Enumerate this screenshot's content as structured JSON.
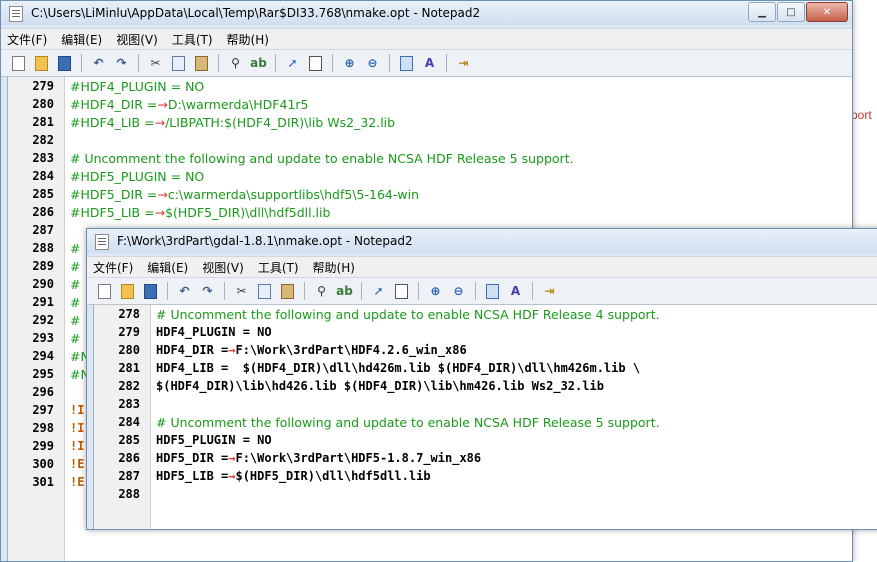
{
  "background": {
    "text": "port"
  },
  "window1": {
    "title": "C:\\Users\\LiMinlu\\AppData\\Local\\Temp\\Rar$DI33.768\\nmake.opt - Notepad2",
    "menu": [
      "文件(F)",
      "编辑(E)",
      "视图(V)",
      "工具(T)",
      "帮助(H)"
    ],
    "lines": [
      {
        "n": "279",
        "t": "#HDF4_PLUGIN = NO",
        "k": "cmt"
      },
      {
        "n": "280",
        "t": "#HDF4_DIR =→D:\\warmerda\\HDF41r5",
        "k": "cmt"
      },
      {
        "n": "281",
        "t": "#HDF4_LIB =→/LIBPATH:$(HDF4_DIR)\\lib Ws2_32.lib",
        "k": "cmt"
      },
      {
        "n": "282",
        "t": "",
        "k": "cmt"
      },
      {
        "n": "283",
        "t": "# Uncomment the following and update to enable NCSA HDF Release 5 support.",
        "k": "cmt"
      },
      {
        "n": "284",
        "t": "#HDF5_PLUGIN = NO",
        "k": "cmt"
      },
      {
        "n": "285",
        "t": "#HDF5_DIR =→c:\\warmerda\\supportlibs\\hdf5\\5-164-win",
        "k": "cmt"
      },
      {
        "n": "286",
        "t": "#HDF5_LIB =→$(HDF5_DIR)\\dll\\hdf5dll.lib",
        "k": "cmt"
      },
      {
        "n": "287",
        "t": "",
        "k": "cmt"
      },
      {
        "n": "288",
        "t": "#",
        "k": "cmt"
      },
      {
        "n": "289",
        "t": "#",
        "k": "cmt"
      },
      {
        "n": "290",
        "t": "#",
        "k": "cmt"
      },
      {
        "n": "291",
        "t": "#",
        "k": "cmt"
      },
      {
        "n": "292",
        "t": "#",
        "k": "cmt"
      },
      {
        "n": "293",
        "t": "#",
        "k": "cmt"
      },
      {
        "n": "294",
        "t": "#N",
        "k": "cmt"
      },
      {
        "n": "295",
        "t": "#N",
        "k": "cmt"
      },
      {
        "n": "296",
        "t": "",
        "k": "cmt"
      },
      {
        "n": "297",
        "t": "!I",
        "k": "warn"
      },
      {
        "n": "298",
        "t": "!I",
        "k": "warn"
      },
      {
        "n": "299",
        "t": "!I",
        "k": "warn"
      },
      {
        "n": "300",
        "t": "!E",
        "k": "warn"
      },
      {
        "n": "301",
        "t": "!E",
        "k": "warn"
      }
    ]
  },
  "window2": {
    "title": "F:\\Work\\3rdPart\\gdal-1.8.1\\nmake.opt - Notepad2",
    "menu": [
      "文件(F)",
      "编辑(E)",
      "视图(V)",
      "工具(T)",
      "帮助(H)"
    ],
    "lines": [
      {
        "n": "278",
        "t": "# Uncomment the following and update to enable NCSA HDF Release 4 support.",
        "k": "cmt"
      },
      {
        "n": "279",
        "t": "HDF4_PLUGIN = NO",
        "k": "code"
      },
      {
        "n": "280",
        "t": "HDF4_DIR =→F:\\Work\\3rdPart\\HDF4.2.6_win_x86",
        "k": "code"
      },
      {
        "n": "281",
        "t": "HDF4_LIB =  $(HDF4_DIR)\\dll\\hd426m.lib $(HDF4_DIR)\\dll\\hm426m.lib \\",
        "k": "code"
      },
      {
        "n": "282",
        "t": "$(HDF4_DIR)\\lib\\hd426.lib $(HDF4_DIR)\\lib\\hm426.lib Ws2_32.lib",
        "k": "code"
      },
      {
        "n": "283",
        "t": "",
        "k": "code"
      },
      {
        "n": "284",
        "t": "# Uncomment the following and update to enable NCSA HDF Release 5 support.",
        "k": "cmt"
      },
      {
        "n": "285",
        "t": "HDF5_PLUGIN = NO",
        "k": "code"
      },
      {
        "n": "286",
        "t": "HDF5_DIR =→F:\\Work\\3rdPart\\HDF5-1.8.7_win_x86",
        "k": "code"
      },
      {
        "n": "287",
        "t": "HDF5_LIB =→$(HDF5_DIR)\\dll\\hdf5dll.lib",
        "k": "code"
      },
      {
        "n": "288",
        "t": "",
        "k": "code"
      }
    ]
  },
  "toolbar_icons": [
    "new-file-icon",
    "open-folder-icon",
    "save-icon",
    "sep",
    "undo-icon",
    "redo-icon",
    "sep",
    "cut-icon",
    "copy-icon",
    "paste-icon",
    "sep",
    "find-icon",
    "replace-icon",
    "sep",
    "goto-icon",
    "bookmark-icon",
    "sep",
    "zoom-in-icon",
    "zoom-out-icon",
    "sep",
    "view-icon",
    "font-icon",
    "sep",
    "exit-icon"
  ],
  "colors": {
    "comment": "#1a9a1a",
    "code": "#000000",
    "warning": "#c55a00",
    "arrow": "#e04040"
  }
}
